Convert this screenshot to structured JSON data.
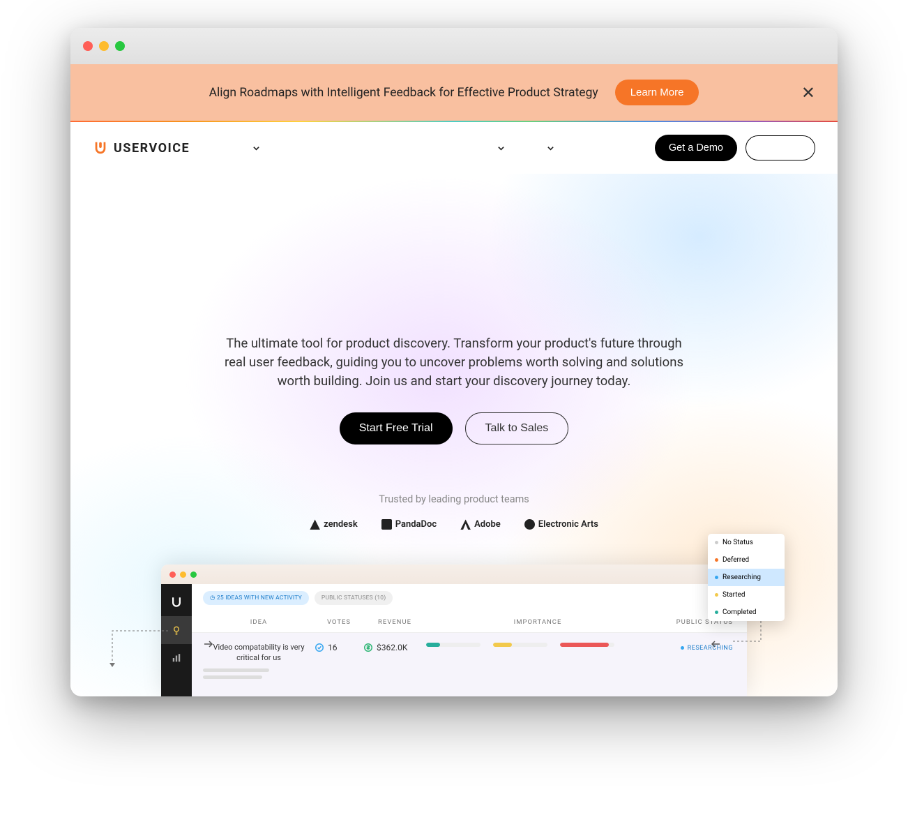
{
  "announce": {
    "text": "Align Roadmaps with Intelligent Feedback for Effective Product Strategy",
    "cta": "Learn More"
  },
  "brand": {
    "name": "USERVOICE"
  },
  "nav": {
    "demo": "Get a Demo",
    "signin": ""
  },
  "hero": {
    "subtitle": "The ultimate tool for product discovery. Transform your product's future through real user feedback, guiding you to uncover problems worth solving and solutions worth building. Join us and start your discovery journey today.",
    "primary": "Start Free Trial",
    "secondary": "Talk to Sales",
    "trusted": "Trusted by leading product teams"
  },
  "logos": {
    "zendesk": "zendesk",
    "pandadoc": "PandaDoc",
    "adobe": "Adobe",
    "ea": "Electronic Arts"
  },
  "mini": {
    "chip_activity": "25 IDEAS WITH NEW ACTIVITY",
    "chip_statuses": "PUBLIC STATUSES (10)",
    "cols": {
      "idea": "IDEA",
      "votes": "VOTES",
      "revenue": "REVENUE",
      "importance": "IMPORTANCE",
      "status": "PUBLIC STATUS"
    },
    "row": {
      "idea": "Video compatability is very critical for us",
      "votes": "16",
      "revenue": "$362.0K",
      "status": "RESEARCHING"
    }
  },
  "popup": {
    "nostatus": "No Status",
    "deferred": "Deferred",
    "researching": "Researching",
    "started": "Started",
    "completed": "Completed"
  }
}
